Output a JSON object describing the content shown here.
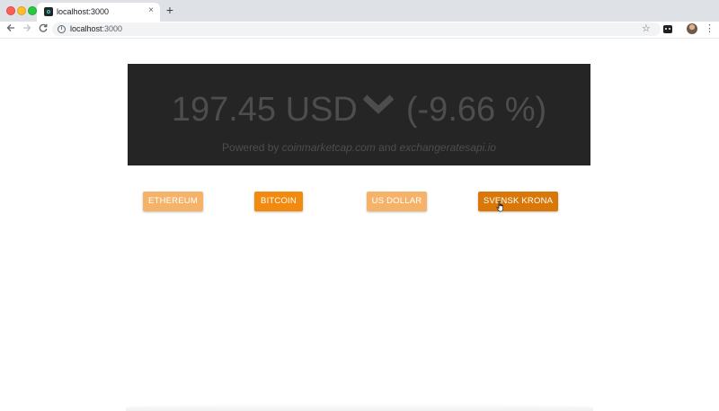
{
  "browser": {
    "tab_title": "localhost:3000",
    "tab_close": "×",
    "new_tab": "+",
    "url_host": "localhost",
    "url_port": ":3000",
    "icons": [
      "back-arrow-icon",
      "forward-arrow-icon",
      "reload-icon",
      "info-icon",
      "star-icon",
      "extension-icon",
      "avatar",
      "menu-dots-icon"
    ]
  },
  "price": {
    "value": "197.45",
    "currency": "USD",
    "trend_icon": "chevron-down-icon",
    "change": "(-9.66 %)",
    "powered_prefix": "Powered by",
    "source1": "coinmarketcap.com",
    "powered_and": "and",
    "source2": "exchangeratesapi.io"
  },
  "buttons": {
    "ethereum": "ETHEREUM",
    "bitcoin": "BITCOIN",
    "us_dollar": "US DOLLAR",
    "svensk_krona": "SVENSK KRONA"
  },
  "colors": {
    "card_bg": "#252525",
    "card_text": "#4d4d4d",
    "button_light": "#f5b36a",
    "button_active": "#f18a0e",
    "button_hover": "#d97808"
  }
}
